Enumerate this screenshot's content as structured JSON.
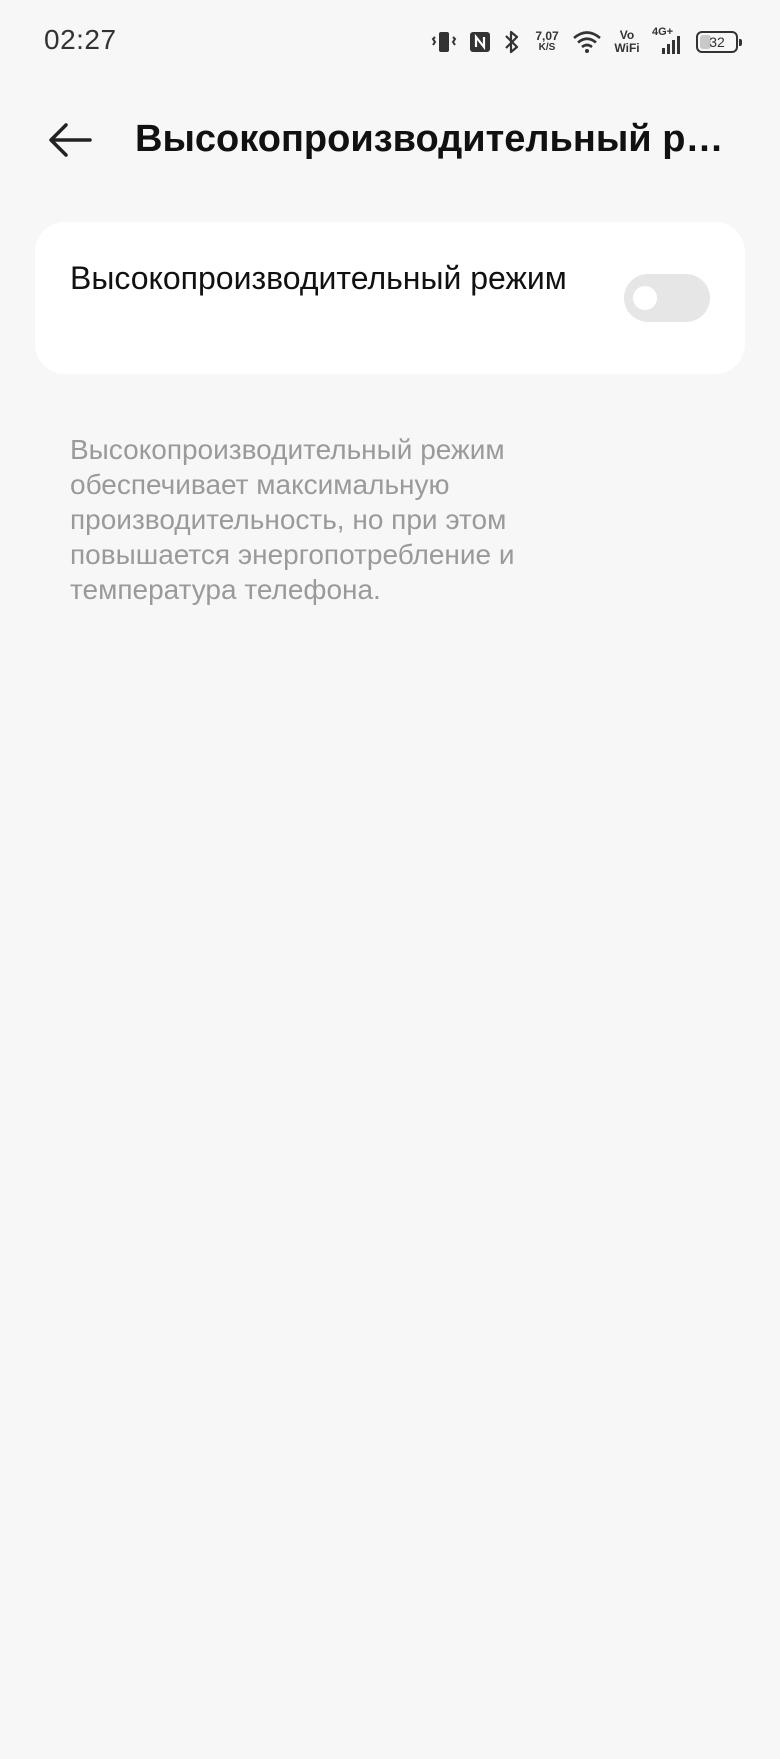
{
  "status_bar": {
    "time": "02:27",
    "net_speed_value": "7,07",
    "net_speed_unit": "K/S",
    "vowifi_top": "Vo",
    "vowifi_bottom": "WiFi",
    "network_type": "4G+",
    "battery_percent": "32",
    "battery_level": 0.32,
    "icons": [
      "vibrate-icon",
      "nfc-icon",
      "bluetooth-icon",
      "wifi-icon",
      "signal-icon",
      "battery-icon"
    ]
  },
  "header": {
    "back_icon": "arrow-left-icon",
    "title": "Высокопроизводительный режим"
  },
  "setting": {
    "label": "Высокопроизводительный режим",
    "enabled": false
  },
  "description": "Высокопроизводительный режим обеспечивает максимальную производительность, но при этом повышается энергопотребление и температура телефона."
}
